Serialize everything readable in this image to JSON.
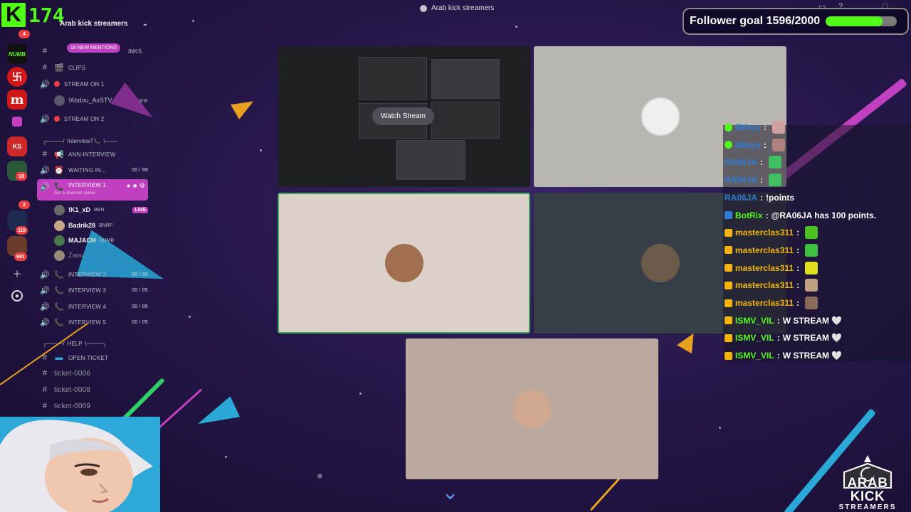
{
  "window": {
    "title": "Arab kick streamers"
  },
  "kick": {
    "logo": "K",
    "count": "174"
  },
  "follower_goal": {
    "text": "Follower goal 1596/2000",
    "current": 1596,
    "target": 2000
  },
  "rail": {
    "badges": [
      "4",
      "18",
      "2",
      "115",
      "691"
    ],
    "servers": [
      {
        "label": "NUMB",
        "color": "#111111"
      },
      {
        "label": "卐",
        "color": "#d01818"
      },
      {
        "label": "m",
        "color": "#d01818"
      },
      {
        "label": "KS",
        "color": "#d02828"
      }
    ]
  },
  "channels": {
    "server_name": "Arab kick streamers",
    "mentions": "18 NEW MENTIONS",
    "partial_link": "INKS",
    "clips": "CLIPS",
    "stream_on_1": "STREAM ON 1",
    "stream_on_1_user": "!Abdou_AxSTV",
    "stream_on_2": "STREAM ON 2",
    "interview_divider": "InterviewT📞",
    "ann_interview": "ANN-INTERVIEW",
    "waiting": "WAITING IN...",
    "waiting_count": "00 / 99",
    "interview1": "INTERVIEW 1",
    "interview1_status": "Set a channel status",
    "users": [
      {
        "name": "!K1_xD",
        "tag": "BBN",
        "live": "LIVE"
      },
      {
        "name": "Badrik28",
        "tag": "BNRP"
      },
      {
        "name": "MAJACH",
        "tag": "NUMB"
      },
      {
        "name": "Zaraz"
      }
    ],
    "interview2": "INTERVIEW 2",
    "interview2_count": "00 / 05",
    "interview3": "INTERVIEW 3",
    "interview3_count": "00 / 05",
    "interview4": "INTERVIEW 4",
    "interview4_count": "00 / 05",
    "interview5": "INTERVIEW 5",
    "interview5_count": "00 / 05",
    "help_divider": "HELP",
    "open_ticket": "OPEN-TICKET",
    "tickets": [
      "ticket-0006",
      "ticket-0008",
      "ticket-0009"
    ]
  },
  "stage": {
    "watch_stream": "Watch Stream"
  },
  "chat": [
    {
      "user": "6Meyz",
      "text": "",
      "user_color": "#2e7bd6",
      "badge": "verified"
    },
    {
      "user": "6Meyz",
      "text": "",
      "user_color": "#2e7bd6",
      "badge": "verified"
    },
    {
      "user": "RA06JA",
      "text": "",
      "user_color": "#2e7bd6",
      "badge": ""
    },
    {
      "user": "RA06JA",
      "text": "",
      "user_color": "#2e7bd6",
      "badge": ""
    },
    {
      "user": "RA06JA",
      "text": "!points",
      "user_color": "#2e7bd6",
      "badge": ""
    },
    {
      "user": "BotRix",
      "text": "@RA06JA has 100 points.",
      "user_color": "#53fc18",
      "badge": "bot"
    },
    {
      "user": "masterclas311",
      "text": "",
      "user_color": "#f5b400",
      "badge": "crown"
    },
    {
      "user": "masterclas311",
      "text": "",
      "user_color": "#f5b400",
      "badge": "crown"
    },
    {
      "user": "masterclas311",
      "text": "",
      "user_color": "#f5b400",
      "badge": "crown"
    },
    {
      "user": "masterclas311",
      "text": "",
      "user_color": "#f5b400",
      "badge": "crown"
    },
    {
      "user": "masterclas311",
      "text": "",
      "user_color": "#f5b400",
      "badge": "crown"
    },
    {
      "user": "ISMV_VIL",
      "text": "W STREAM 🤍",
      "user_color": "#53fc18",
      "badge": "crown"
    },
    {
      "user": "ISMV_VIL",
      "text": "W STREAM 🤍",
      "user_color": "#53fc18",
      "badge": "crown"
    },
    {
      "user": "ISMV_VIL",
      "text": "W STREAM 🤍",
      "user_color": "#53fc18",
      "badge": "crown"
    }
  ],
  "logo": {
    "main": "ARAB KICK",
    "sub": "STREAMERS"
  }
}
